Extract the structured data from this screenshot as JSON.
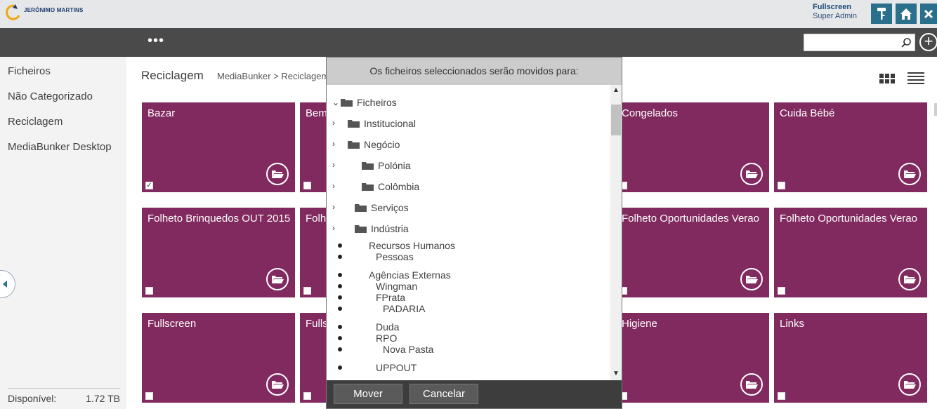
{
  "brand": {
    "name": "JERÓNIMO MARTINS"
  },
  "user": {
    "name": "Fullscreen",
    "role": "Super Admin"
  },
  "header_icons": [
    "key-icon",
    "home-icon",
    "close-icon"
  ],
  "toolbar": {
    "more_label": "•••",
    "search_placeholder": ""
  },
  "sidebar": {
    "items": [
      {
        "label": "Ficheiros"
      },
      {
        "label": "Não Categorizado"
      },
      {
        "label": "Reciclagem"
      },
      {
        "label": "MediaBunker Desktop"
      }
    ],
    "available_label": "Disponível:",
    "available_value": "1.72 TB"
  },
  "main": {
    "title": "Reciclagem",
    "breadcrumb": "MediaBunker  >  Reciclagem",
    "tiles": [
      {
        "label": "Bazar",
        "checked": true
      },
      {
        "label": "Bem",
        "checked": false
      },
      {
        "label": "Congelados",
        "checked": false
      },
      {
        "label": "Cuida Bébé",
        "checked": false
      },
      {
        "label": "Folheto Brinquedos OUT 2015",
        "checked": false
      },
      {
        "label": "Folh",
        "checked": false
      },
      {
        "label": "Folheto Oportunidades Verao",
        "checked": false
      },
      {
        "label": "Folheto Oportunidades Verao",
        "checked": false
      },
      {
        "label": "Fullscreen",
        "checked": false
      },
      {
        "label": "Fulls",
        "checked": false
      },
      {
        "label": "Higiene",
        "checked": false
      },
      {
        "label": "Links",
        "checked": false
      }
    ]
  },
  "colors": {
    "tile": "#812a5f",
    "accent": "#2a6f8c",
    "toolbar": "#4a4a4a"
  },
  "modal": {
    "title": "Os ficheiros seleccionados serão movidos para:",
    "tree": [
      {
        "label": "Ficheiros"
      },
      {
        "label": "Institucional"
      },
      {
        "label": "Negócio"
      },
      {
        "label": "Polónia"
      },
      {
        "label": "Colômbia"
      },
      {
        "label": "Serviços"
      },
      {
        "label": "Indústria"
      }
    ],
    "plain_items": [
      {
        "label": "Recursos Humanos"
      },
      {
        "label": "Pessoas"
      },
      {
        "label": "Agências Externas"
      },
      {
        "label": "Wingman"
      },
      {
        "label": "FPrata"
      },
      {
        "label": "PADARIA"
      },
      {
        "label": "Duda"
      },
      {
        "label": "RPO"
      },
      {
        "label": "Nova Pasta"
      },
      {
        "label": "UPPOUT"
      }
    ],
    "move_label": "Mover",
    "cancel_label": "Cancelar"
  }
}
